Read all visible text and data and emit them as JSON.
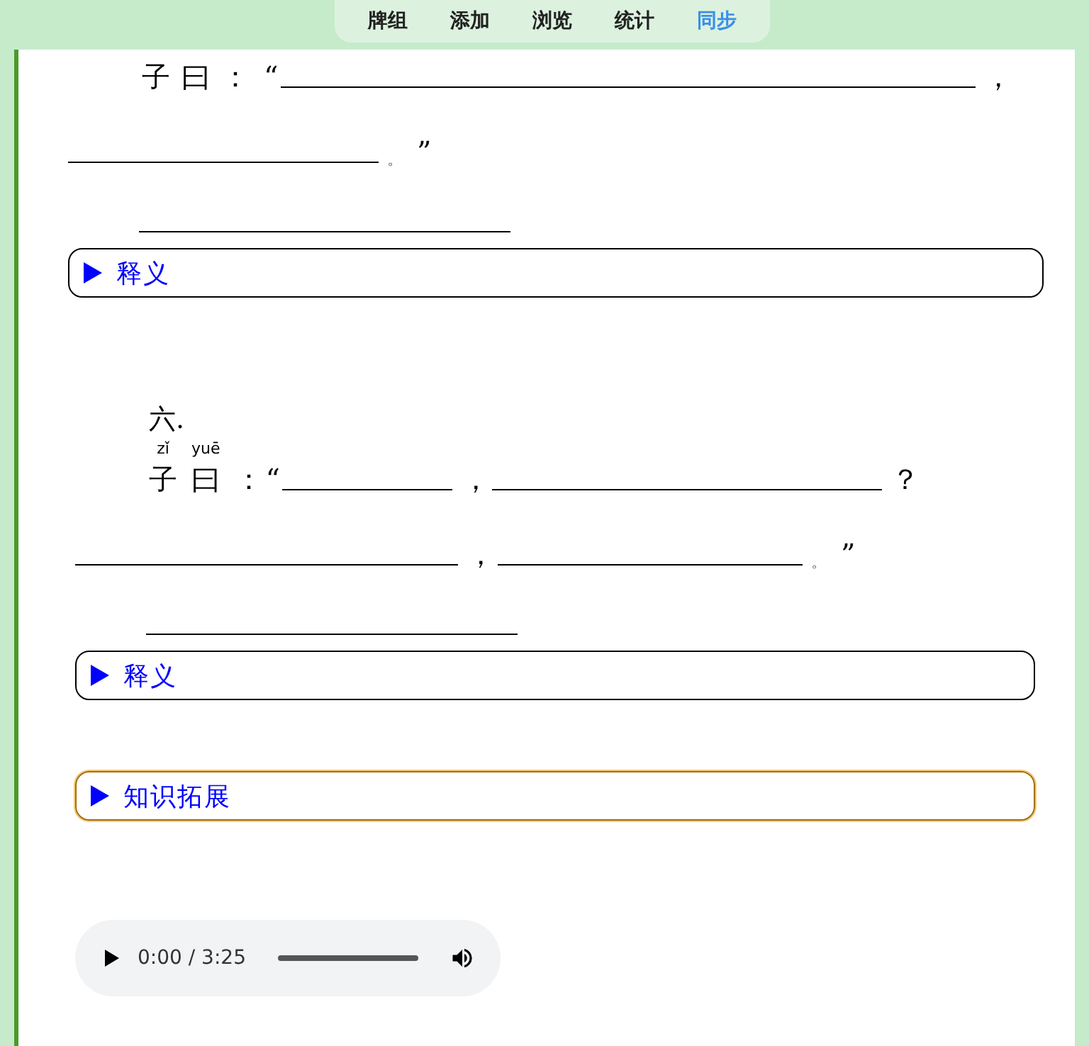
{
  "nav": {
    "tabs": [
      {
        "label": "牌组",
        "selected": false
      },
      {
        "label": "添加",
        "selected": false
      },
      {
        "label": "浏览",
        "selected": false
      },
      {
        "label": "统计",
        "selected": false
      },
      {
        "label": "同步",
        "selected": true
      }
    ]
  },
  "sections": [
    {
      "lines": [
        [
          {
            "kind": "text",
            "text": "子曰："
          },
          {
            "kind": "text",
            "text": "“"
          },
          {
            "kind": "blank"
          },
          {
            "kind": "text",
            "text": "，"
          }
        ],
        [
          {
            "kind": "blank"
          },
          {
            "kind": "small",
            "text": "。"
          },
          {
            "kind": "text",
            "text": "”"
          }
        ]
      ],
      "details": [
        {
          "label": "释义",
          "kind": "plain"
        }
      ]
    },
    {
      "number": "六.",
      "lines": [
        [
          {
            "kind": "ruby",
            "text": "子",
            "pinyin": "zǐ"
          },
          {
            "kind": "ruby",
            "text": "曰",
            "pinyin": "yuē"
          },
          {
            "kind": "text",
            "text": "："
          },
          {
            "kind": "text",
            "text": "“"
          },
          {
            "kind": "blank"
          },
          {
            "kind": "text",
            "text": "，"
          },
          {
            "kind": "blank"
          },
          {
            "kind": "text",
            "text": "？"
          }
        ],
        [
          {
            "kind": "blank"
          },
          {
            "kind": "text",
            "text": "，"
          },
          {
            "kind": "blank"
          },
          {
            "kind": "small",
            "text": "。"
          },
          {
            "kind": "text",
            "text": "”"
          }
        ]
      ],
      "details": [
        {
          "label": "释义",
          "kind": "plain"
        },
        {
          "label": "知识拓展",
          "kind": "highlight"
        }
      ]
    }
  ],
  "audio": {
    "time": "0:00 / 3:25"
  }
}
